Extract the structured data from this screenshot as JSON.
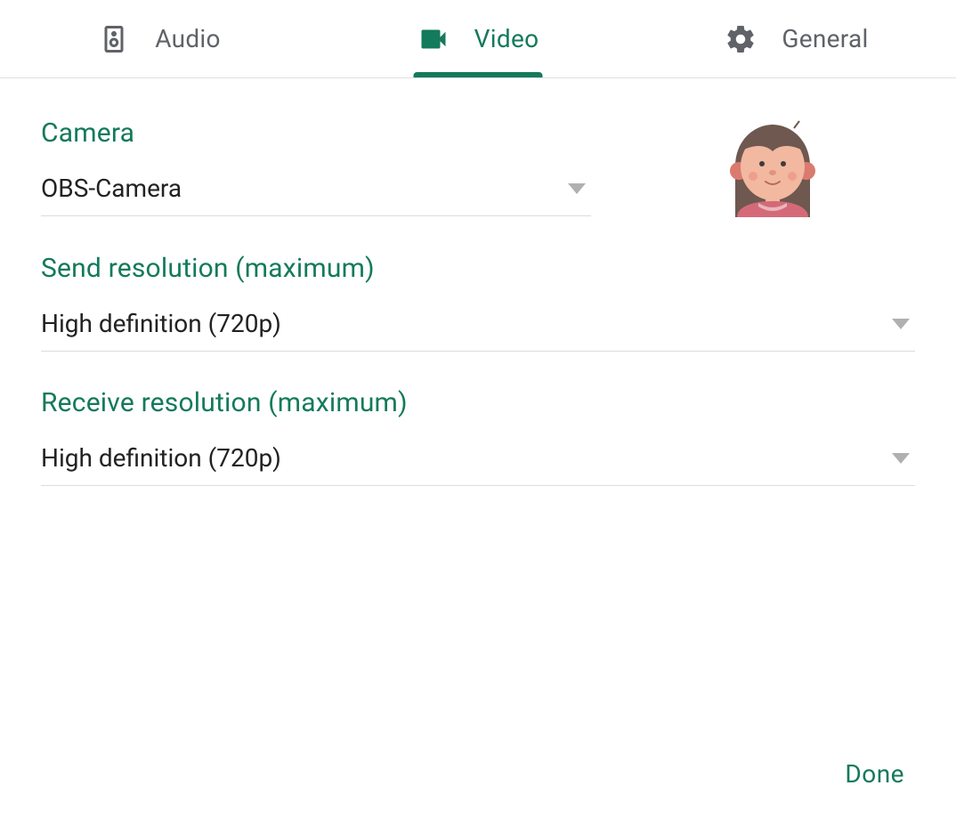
{
  "tabs": {
    "audio": {
      "label": "Audio"
    },
    "video": {
      "label": "Video"
    },
    "general": {
      "label": "General"
    }
  },
  "camera": {
    "label": "Camera",
    "value": "OBS-Camera"
  },
  "send_resolution": {
    "label": "Send resolution (maximum)",
    "value": "High definition (720p)"
  },
  "receive_resolution": {
    "label": "Receive resolution (maximum)",
    "value": "High definition (720p)"
  },
  "footer": {
    "done_label": "Done"
  }
}
